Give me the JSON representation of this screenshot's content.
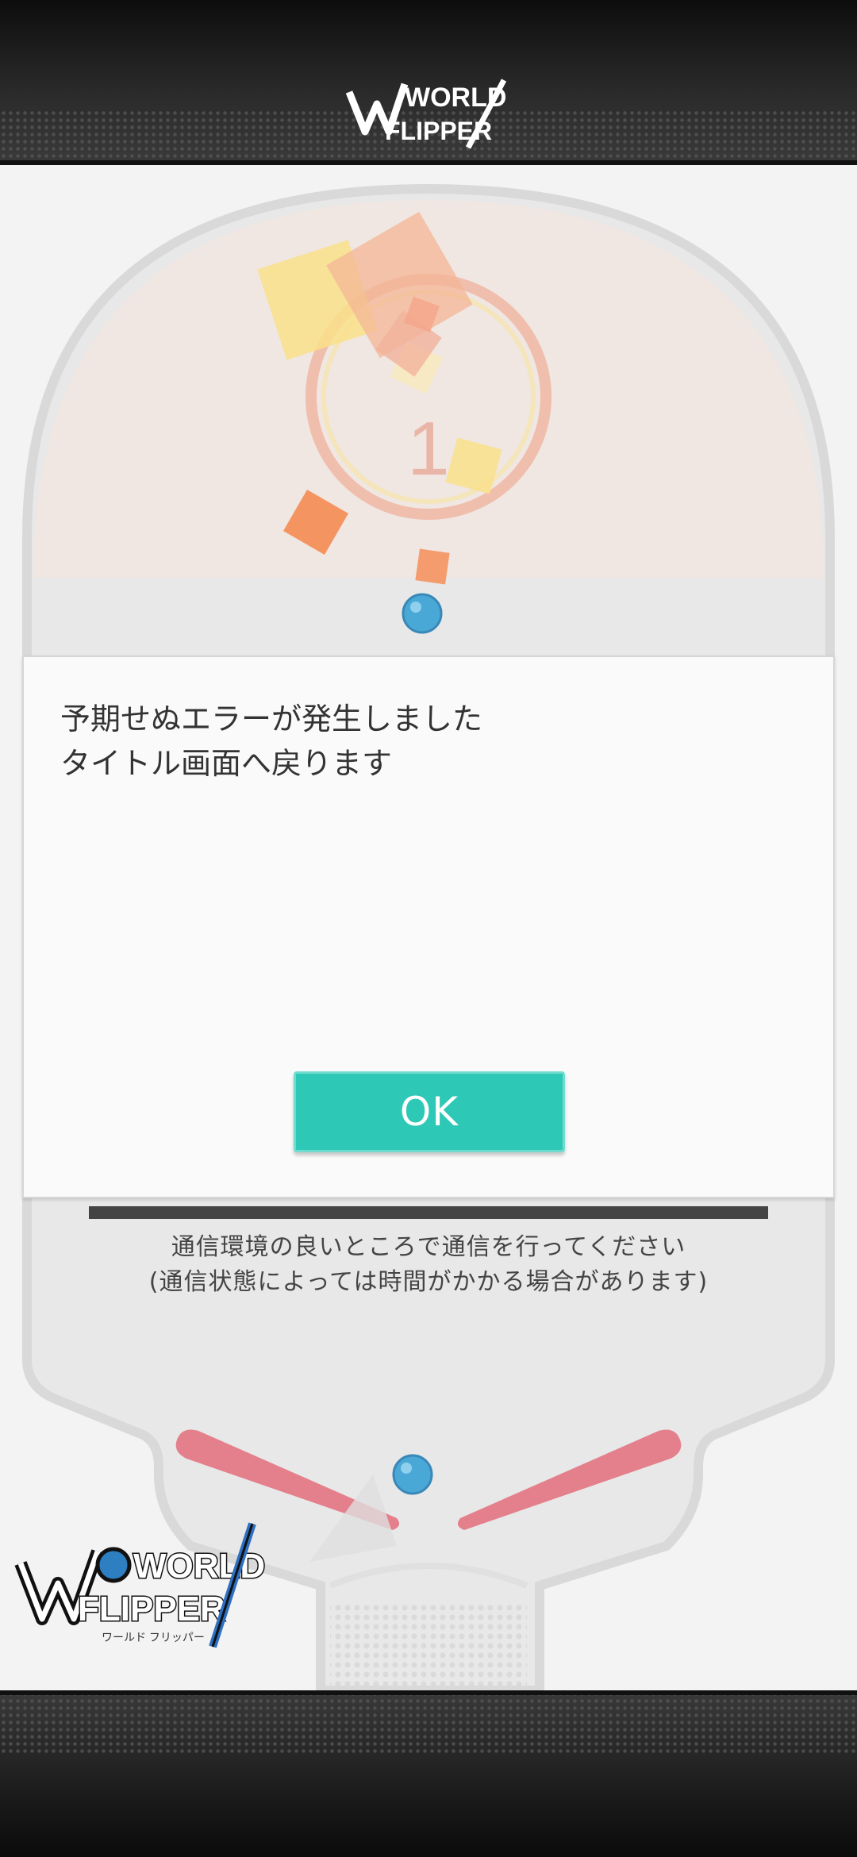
{
  "header": {
    "logo_text_line1": "WORLD",
    "logo_text_line2": "FLIPPER"
  },
  "loading": {
    "counter": "1"
  },
  "dialog": {
    "message_line1": "予期せぬエラーが発生しました",
    "message_line2": "タイトル画面へ戻ります",
    "ok_label": "OK"
  },
  "status": {
    "notice_line1": "通信環境の良いところで通信を行ってください",
    "notice_line2": "(通信状態によっては時間がかかる場合があります)"
  },
  "branding": {
    "logo_line1": "WORLD",
    "logo_line2": "FLIPPER",
    "logo_kana": "ワールド フリッパー"
  },
  "colors": {
    "accent": "#2ec8b6",
    "flipper": "#e4808c",
    "ball": "#4aa8d6"
  }
}
